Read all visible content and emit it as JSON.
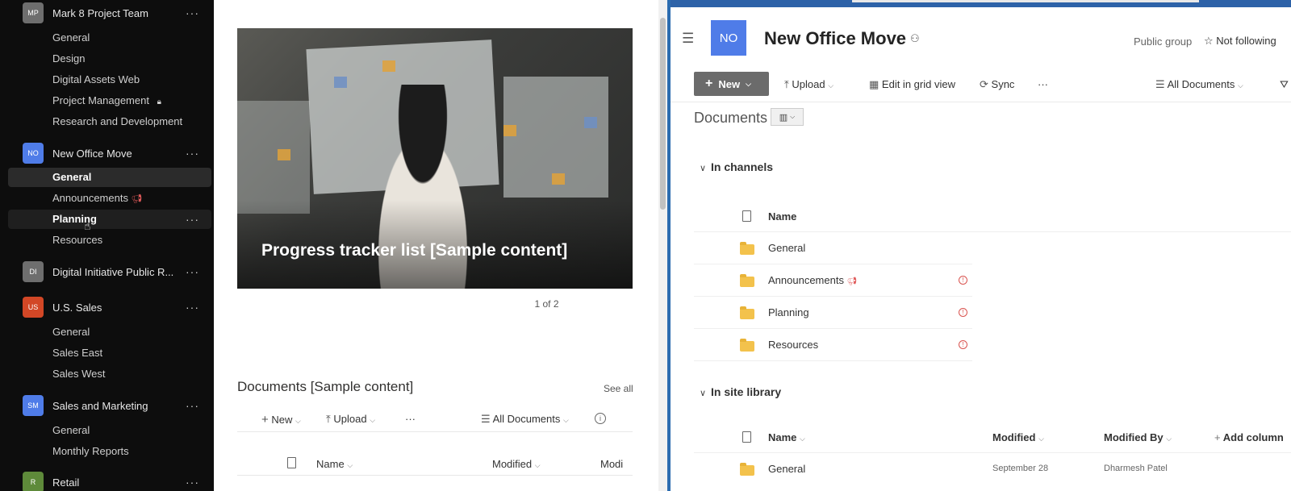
{
  "sidebar": {
    "teams": [
      {
        "avatar": "MP",
        "avatar_color": "#6e6e6e",
        "name": "Mark 8 Project Team",
        "channels": [
          "General",
          "Design",
          "Digital Assets Web",
          "Project Management",
          "Research and Development"
        ]
      },
      {
        "avatar": "NO",
        "avatar_color": "#4f7ce8",
        "name": "New Office Move",
        "channels": [
          "General",
          "Announcements",
          "Planning",
          "Resources"
        ]
      },
      {
        "avatar": "DI",
        "avatar_color": "#6e6e6e",
        "name": "Digital Initiative Public R..."
      },
      {
        "avatar": "US",
        "avatar_color": "#d24726",
        "name": "U.S. Sales",
        "channels": [
          "General",
          "Sales East",
          "Sales West"
        ]
      },
      {
        "avatar": "SM",
        "avatar_color": "#4f7ce8",
        "name": "Sales and Marketing",
        "channels": [
          "General",
          "Monthly Reports"
        ]
      },
      {
        "avatar": "R",
        "avatar_color": "#5e8a3a",
        "name": "Retail"
      }
    ],
    "more": "···"
  },
  "middle": {
    "hero_title": "Progress tracker list [Sample content]",
    "pager": "1 of 2",
    "docs_title": "Documents [Sample content]",
    "see_all": "See all",
    "toolbar": {
      "new": "New",
      "upload": "Upload",
      "more": "···",
      "view": "All Documents"
    },
    "columns": {
      "name": "Name",
      "modified": "Modified",
      "modified_by": "Modi"
    }
  },
  "right": {
    "site_logo": "NO",
    "site_title": "New Office Move",
    "privacy": "Public group",
    "follow": "Not following",
    "commands": {
      "new": "New",
      "upload": "Upload",
      "grid": "Edit in grid view",
      "sync": "Sync",
      "more": "···",
      "view": "All Documents"
    },
    "docs_heading": "Documents",
    "groups": {
      "channels": {
        "title": "In channels",
        "column_name": "Name",
        "rows": [
          "General",
          "Announcements",
          "Planning",
          "Resources"
        ]
      },
      "library": {
        "title": "In site library",
        "columns": {
          "name": "Name",
          "modified": "Modified",
          "modified_by": "Modified By",
          "add": "Add column"
        },
        "rows": [
          {
            "name": "General",
            "modified": "September 28",
            "modified_by": "Dharmesh Patel"
          }
        ]
      }
    }
  }
}
